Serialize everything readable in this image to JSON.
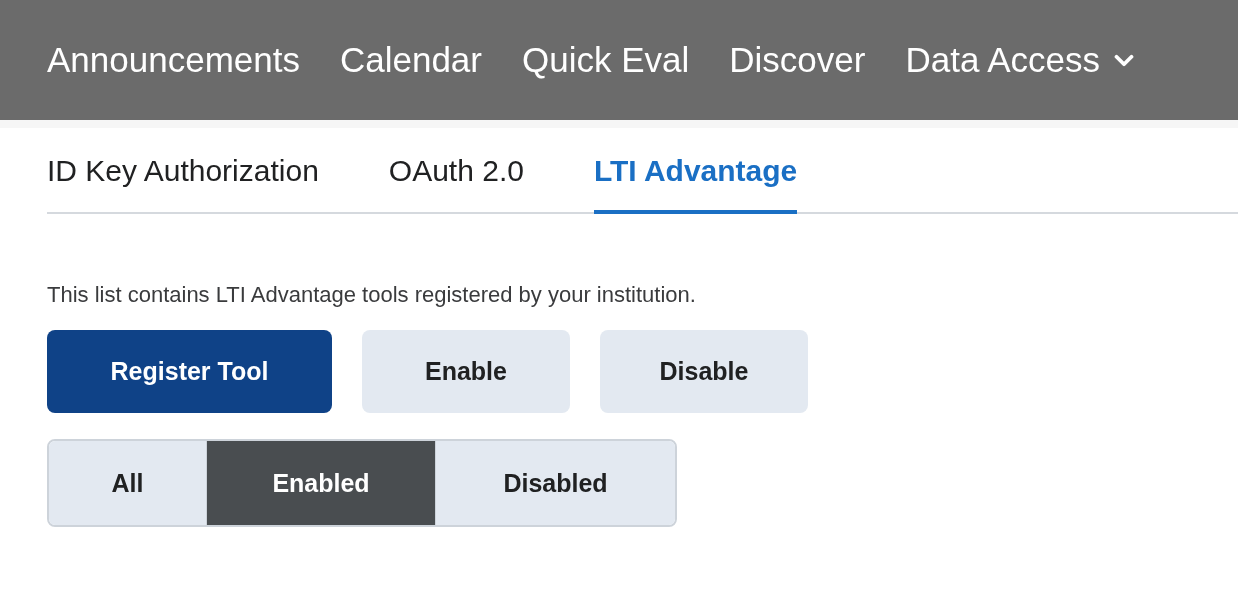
{
  "nav": [
    {
      "label": "Announcements",
      "kind": "link"
    },
    {
      "label": "Calendar",
      "kind": "link"
    },
    {
      "label": "Quick Eval",
      "kind": "link"
    },
    {
      "label": "Discover",
      "kind": "link"
    },
    {
      "label": "Data Access",
      "kind": "dropdown"
    }
  ],
  "tabs": [
    {
      "label": "ID Key Authorization",
      "selected": false
    },
    {
      "label": "OAuth 2.0",
      "selected": false
    },
    {
      "label": "LTI Advantage",
      "selected": true
    }
  ],
  "description": "This list contains LTI Advantage tools registered by your institution.",
  "buttons": [
    {
      "label": "Register Tool",
      "kind": "primary"
    },
    {
      "label": "Enable",
      "kind": "secondary"
    },
    {
      "label": "Disable",
      "kind": "secondary"
    }
  ],
  "filters": [
    {
      "label": "All",
      "selected": false
    },
    {
      "label": "Enabled",
      "selected": true
    },
    {
      "label": "Disabled",
      "selected": false
    }
  ]
}
